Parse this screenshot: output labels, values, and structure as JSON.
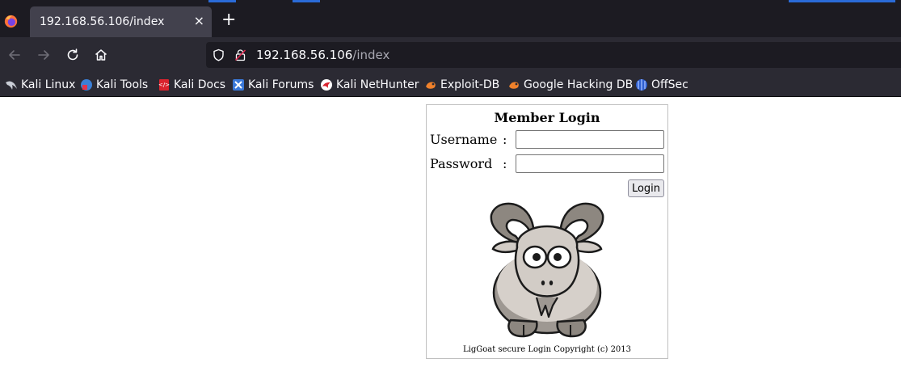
{
  "browser": {
    "tab": {
      "title": "192.168.56.106/index",
      "close_label": "×"
    },
    "new_tab_label": "+",
    "url": {
      "host": "192.168.56.106",
      "path": "/index"
    },
    "bookmarks": [
      {
        "label": "Kali Linux",
        "icon": "kali-dragon-icon"
      },
      {
        "label": "Kali Tools",
        "icon": "kali-tools-icon"
      },
      {
        "label": "Kali Docs",
        "icon": "kali-docs-icon"
      },
      {
        "label": "Kali Forums",
        "icon": "kali-forums-icon"
      },
      {
        "label": "Kali NetHunter",
        "icon": "nethunter-icon"
      },
      {
        "label": "Exploit-DB",
        "icon": "exploit-db-icon"
      },
      {
        "label": "Google Hacking DB",
        "icon": "ghdb-icon"
      },
      {
        "label": "OffSec",
        "icon": "offsec-icon"
      }
    ],
    "colors": {
      "tabbar": "#1c1b22",
      "toolbar": "#2b2a33",
      "active_tab": "#42414d",
      "accent": "#2a6bd8"
    }
  },
  "page": {
    "title": "Member Login",
    "username_label": "Username",
    "password_label": "Password",
    "colon": ":",
    "username_value": "",
    "password_value": "",
    "login_button": "Login",
    "image": "goat-mascot",
    "copyright": "LigGoat secure Login Copyright (c) 2013"
  }
}
